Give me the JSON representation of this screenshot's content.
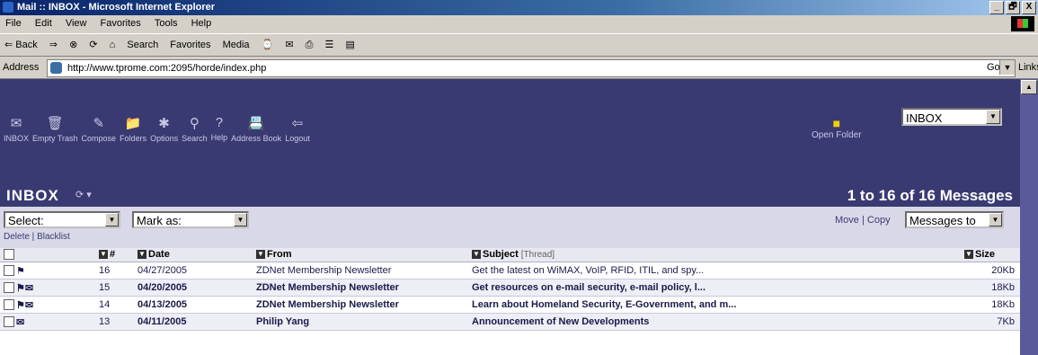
{
  "window": {
    "title": "Mail :: INBOX - Microsoft Internet Explorer",
    "buttons": [
      "_",
      "🗗",
      "X"
    ]
  },
  "menu": [
    "File",
    "Edit",
    "View",
    "Favorites",
    "Tools",
    "Help"
  ],
  "toolbar": [
    "⇐ Back",
    "⇒",
    "⊗",
    "⟳",
    "⌂",
    "Search",
    "Favorites",
    "Media",
    "⌚",
    "✉",
    "⎙",
    "☰",
    "▤"
  ],
  "address": {
    "label": "Address",
    "url": "http://www.tprome.com:2095/horde/index.php",
    "go": "Go",
    "links": "Links"
  },
  "nav": [
    {
      "icon": "inbox-icon",
      "glyph": "✉",
      "label": "INBOX"
    },
    {
      "icon": "trash-icon",
      "glyph": "🗑",
      "label": "Empty Trash"
    },
    {
      "icon": "compose-icon",
      "glyph": "✎",
      "label": "Compose"
    },
    {
      "icon": "folders-icon",
      "glyph": "📁",
      "label": "Folders"
    },
    {
      "icon": "options-icon",
      "glyph": "✱",
      "label": "Options"
    },
    {
      "icon": "search-icon",
      "glyph": "⚲",
      "label": "Search"
    },
    {
      "icon": "help-icon",
      "glyph": "?",
      "label": "Help"
    },
    {
      "icon": "address-book-icon",
      "glyph": "📇",
      "label": "Address Book"
    },
    {
      "icon": "logout-icon",
      "glyph": "⇦",
      "label": "Logout"
    }
  ],
  "open_folder": {
    "label": "Open Folder",
    "value": "INBOX"
  },
  "mailbox": {
    "title": "INBOX",
    "count": "1 to 16 of 16 Messages"
  },
  "controls": {
    "select": "Select:",
    "mark_as": "Mark as:",
    "delete": "Delete",
    "blacklist": "Blacklist",
    "move": "Move",
    "copy": "Copy",
    "messages_to": "Messages to"
  },
  "columns": {
    "num": "#",
    "date": "Date",
    "from": "From",
    "subject": "Subject",
    "thread": "[Thread]",
    "size": "Size"
  },
  "messages": [
    {
      "num": "16",
      "date": "04/27/2005",
      "from": "ZDNet Membership Newsletter",
      "subject": "Get the latest on WiMAX, VoIP, RFID, ITIL, and spy...",
      "size": "20Kb",
      "unread": false,
      "status": "⚑"
    },
    {
      "num": "15",
      "date": "04/20/2005",
      "from": "ZDNet Membership Newsletter",
      "subject": "Get resources on e-mail security, e-mail policy, l...",
      "size": "18Kb",
      "unread": true,
      "status": "⚑✉"
    },
    {
      "num": "14",
      "date": "04/13/2005",
      "from": "ZDNet Membership Newsletter",
      "subject": "Learn about Homeland Security, E-Government, and m...",
      "size": "18Kb",
      "unread": true,
      "status": "⚑✉"
    },
    {
      "num": "13",
      "date": "04/11/2005",
      "from": "Philip Yang",
      "subject": "Announcement of New Developments",
      "size": "7Kb",
      "unread": true,
      "status": "✉"
    }
  ]
}
